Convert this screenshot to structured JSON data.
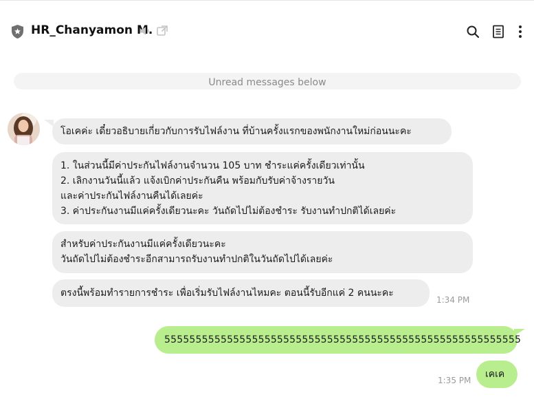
{
  "header": {
    "title": "HR_Chanyamon M.",
    "icons": [
      "shield-icon",
      "mute-icon",
      "external-window-icon",
      "search-icon",
      "notes-icon",
      "more-vertical-icon"
    ]
  },
  "unread_divider": "Unread messages below",
  "messages_in": {
    "m1": "โอเคค่ะ เดี๋ยวอธิบายเกี่ยวกับการรับไฟล์งาน ที่บ้านครั้งแรกของพนักงานใหม่ก่อนนะคะ",
    "m2": {
      "line1": "1.  ในส่วนนี้มีค่าประกันไฟล์งานจำนวน 105 บาท ชำระแค่ครั้งเดียวเท่านั้น",
      "line2": "2.  เลิกงานวันนี้แล้ว แจ้งเบิกค่าประกันคืน พร้อมกับรับค่าจ้างรายวัน",
      "line3": "และค่าประกันไฟล์งานคืนได้เลยค่ะ",
      "line4": "3.  ค่าประกันงานมีแค่ครั้งเดียวนะคะ วันถัดไปไม่ต้องชำระ รับงานทำปกติได้เลยค่ะ"
    },
    "m3": {
      "line1": "สำหรับค่าประกันงานมีแค่ครั้งเดียวนะคะ",
      "line2": "วันถัดไปไม่ต้องชำระอีกสามารถรับงานทำปกติในวันถัดไปได้เลยค่ะ"
    },
    "m4": "ตรงนี้พร้อมทำรายการชำระ เพื่อเริ่มรับไฟล์งานไหมคะ  ตอนนี้รับอีกแค่ 2 คนนะคะ",
    "time": "1:34 PM"
  },
  "messages_out": {
    "m1": "555555555555555555555555555555555555555555555555555555555",
    "m2": "เคเค",
    "time": "1:35 PM"
  },
  "colors": {
    "incoming_bubble": "#ededed",
    "outgoing_bubble": "#b9ee8e",
    "timestamp": "#9a9a9a"
  }
}
